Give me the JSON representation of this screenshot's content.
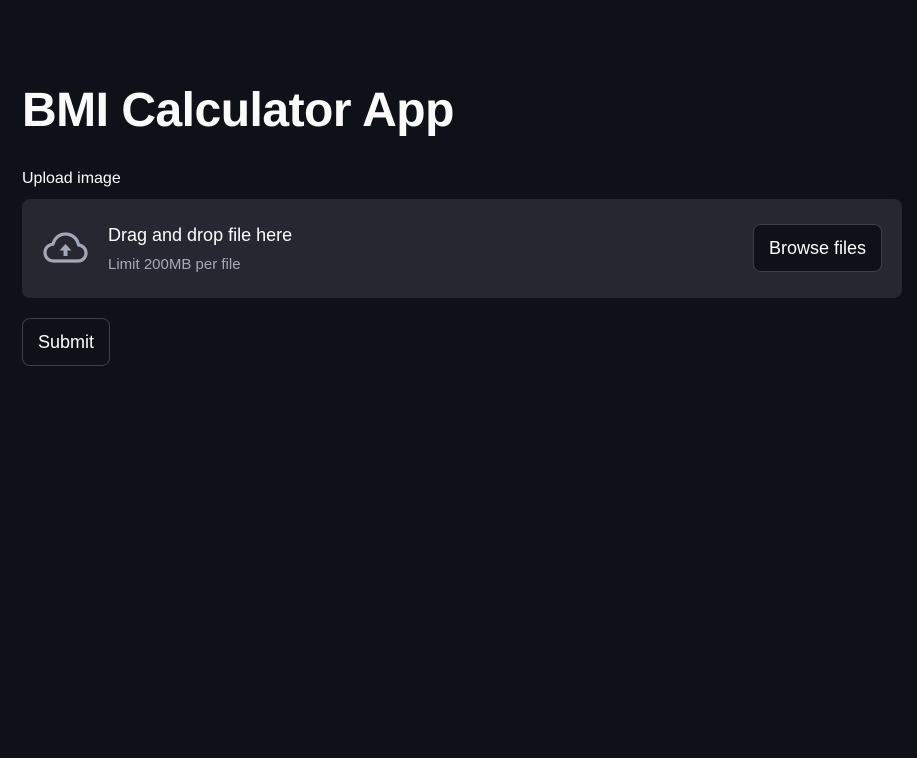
{
  "app": {
    "title": "BMI Calculator App"
  },
  "uploader": {
    "label": "Upload image",
    "icon": "cloud-upload-icon",
    "drop_text": "Drag and drop file here",
    "limit_text": "Limit 200MB per file",
    "browse_label": "Browse files"
  },
  "actions": {
    "submit_label": "Submit"
  },
  "colors": {
    "background": "#0e1117",
    "dropzone": "#262730",
    "text": "#fafafa",
    "muted_text": "#a3a8b8",
    "icon": "#a3a8b8"
  }
}
